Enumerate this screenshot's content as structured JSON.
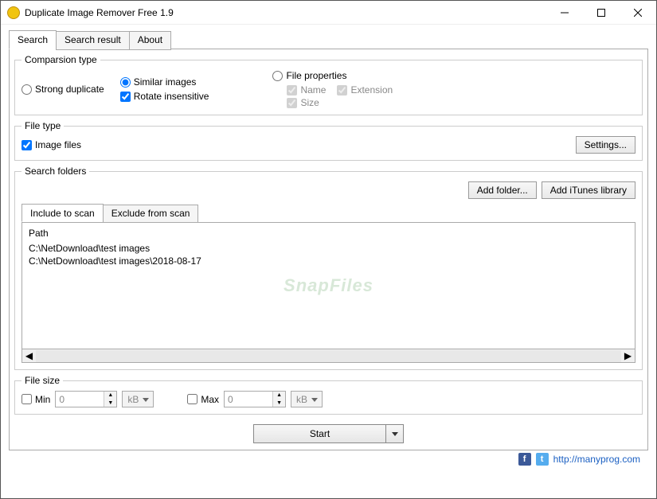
{
  "window": {
    "title": "Duplicate Image Remover Free 1.9"
  },
  "tabs": {
    "search": "Search",
    "result": "Search result",
    "about": "About"
  },
  "comparison": {
    "legend": "Comparsion type",
    "strong": "Strong duplicate",
    "similar": "Similar images",
    "rotate": "Rotate insensitive",
    "fileprops": "File properties",
    "name": "Name",
    "extension": "Extension",
    "size": "Size"
  },
  "filetype": {
    "legend": "File type",
    "images": "Image files",
    "settings": "Settings..."
  },
  "folders": {
    "legend": "Search folders",
    "add": "Add folder...",
    "itunes": "Add iTunes library",
    "include_tab": "Include to scan",
    "exclude_tab": "Exclude from scan",
    "path_header": "Path",
    "paths": [
      "C:\\NetDownload\\test images",
      "C:\\NetDownload\\test images\\2018-08-17"
    ]
  },
  "filesize": {
    "legend": "File size",
    "min": "Min",
    "max": "Max",
    "min_val": "0",
    "max_val": "0",
    "unit": "kB"
  },
  "start": "Start",
  "footer": {
    "link": "http://manyprog.com"
  },
  "watermark": "SnapFiles"
}
